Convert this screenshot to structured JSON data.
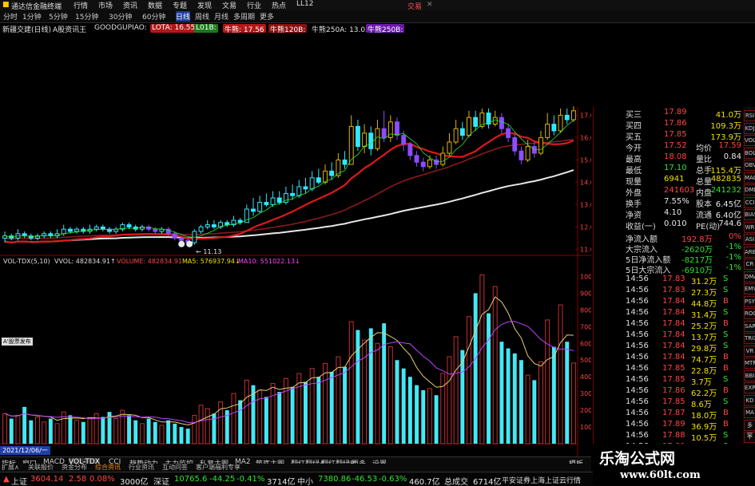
{
  "window": {
    "title": "通达信金融终端",
    "title_right": "交易",
    "close_label": "✕"
  },
  "menu": [
    "行情",
    "市场",
    "资讯",
    "数据",
    "专题",
    "发现",
    "文易",
    "行业",
    "热点",
    "LL12"
  ],
  "periods": [
    "分时",
    "1分钟",
    "5分钟",
    "15分钟",
    "30分钟",
    "60分钟",
    "日线",
    "周线",
    "月线",
    "多周期",
    "更多"
  ],
  "info": {
    "name": "新疆交建(日线)",
    "tool": "A股资讯王",
    "formula": "GOODGUPIAO:",
    "ma250": "牛熊250A: 13.05",
    "chips": [
      "LOTA: 16.55",
      "L01B: ",
      "牛熊: 17.56",
      "牛熊120B:",
      "牛熊250B:"
    ]
  },
  "price_axis": [
    "17.00",
    "16.00",
    "15.00",
    "14.00",
    "13.00",
    "12.00",
    "11.00"
  ],
  "low_label": "← 11.13",
  "vol_header": {
    "ind": "VOL-TDX(5,10)",
    "vvol": "VVOL: 482834.91↑",
    "volume": "VOLUME: 482834.91",
    "ma5": "MA5: 576937.94↓",
    "ma10": "MA10: 551022.13↓"
  },
  "vol_axis": [
    "10000",
    "9000",
    "8000",
    "7000",
    "6000",
    "5000",
    "4000",
    "3000",
    "2000",
    "1000"
  ],
  "vol_badge": "5573",
  "cursor_date": "2021/12/06/一",
  "sidebox_label": "A'股票发布",
  "quote": [
    {
      "l": "买三",
      "v": "17.89",
      "r": "41.0万",
      "lc": "red",
      "rc": "yellow"
    },
    {
      "l": "买四",
      "v": "17.86",
      "r": "109.3万",
      "lc": "red",
      "rc": "yellow"
    },
    {
      "l": "买五",
      "v": "17.85",
      "r": "173.9万",
      "lc": "red",
      "rc": "yellow"
    },
    {
      "l": "今开",
      "v": "17.52",
      "m": "均价",
      "r": "17.59",
      "lc": "red",
      "rc": "red"
    },
    {
      "l": "最高",
      "v": "18.08",
      "m": "量比",
      "r": "0.84",
      "lc": "red",
      "rc": "white"
    },
    {
      "l": "最低",
      "v": "17.10",
      "m": "总手",
      "r": "115.4万",
      "lc": "green",
      "rc": "yellow"
    },
    {
      "l": "现量",
      "v": "6941",
      "m": "总量",
      "r": "482835",
      "lc": "yellow",
      "rc": "yellow"
    },
    {
      "l": "外盘",
      "v": "241603",
      "m": "内盘",
      "r": "241232",
      "lc": "red",
      "rc": "green"
    },
    {
      "l": "换手",
      "v": "7.55%",
      "m": "股本",
      "r": "6.45亿",
      "lc": "white",
      "rc": "white"
    },
    {
      "l": "净资",
      "v": "4.10",
      "m": "流通",
      "r": "6.40亿",
      "lc": "white",
      "rc": "white"
    },
    {
      "l": "收益(一)",
      "v": "0.010",
      "m": "PE(动)",
      "r": "744.6",
      "lc": "white",
      "rc": "white"
    }
  ],
  "flows": [
    {
      "l": "净流入额",
      "v": "192.8万",
      "r": "0%",
      "vc": "red"
    },
    {
      "l": "大宗流入",
      "v": "-2620万",
      "r": "-1%",
      "vc": "green"
    },
    {
      "l": "5日净流入额",
      "v": "-8217万",
      "r": "-1%",
      "vc": "green"
    },
    {
      "l": "5日大宗流入",
      "v": "-6910万",
      "r": "-1%",
      "vc": "green"
    }
  ],
  "ticks": [
    [
      "14:56",
      "17.83",
      "31.2万",
      "S"
    ],
    [
      "14:56",
      "17.83",
      "27.3万",
      "S"
    ],
    [
      "14:56",
      "17.84",
      "44.8万",
      "B"
    ],
    [
      "14:56",
      "17.84",
      "31.4万",
      "S"
    ],
    [
      "14:56",
      "17.84",
      "25.2万",
      "B"
    ],
    [
      "14:56",
      "17.84",
      "13.7万",
      "S"
    ],
    [
      "14:56",
      "17.84",
      "29.8万",
      "S"
    ],
    [
      "14:56",
      "17.84",
      "74.7万",
      "B"
    ],
    [
      "14:56",
      "17.85",
      "22.8万",
      "B"
    ],
    [
      "14:56",
      "17.85",
      "3.7万",
      "S"
    ],
    [
      "14:56",
      "17.86",
      "62.2万",
      "B"
    ],
    [
      "14:56",
      "17.85",
      "8.6万",
      "S"
    ],
    [
      "14:56",
      "17.87",
      "18.0万",
      "B"
    ],
    [
      "14:56",
      "17.89",
      "36.9万",
      "B"
    ],
    [
      "14:56",
      "17.88",
      "10.5万",
      "S"
    ],
    [
      "14:56",
      "17.89",
      "23.6万",
      "S"
    ]
  ],
  "side_icons": [
    "RSI",
    "KDJ",
    "VOL",
    "BOLL",
    "OBV",
    "MACD",
    "DMI",
    "CCI",
    "BIAS",
    "WR",
    "ASI",
    "ARBR",
    "CR",
    "DMA",
    "EMV",
    "PSY",
    "ROC",
    "SAR",
    "TRIX",
    "VR",
    "MTM",
    "BBI",
    "EXPMA",
    "KD",
    "MA",
    "多空",
    "个股",
    "指标"
  ],
  "bottom_tabs": [
    "指标",
    "窗口",
    "MACD",
    "VOL-TDX",
    "CCI",
    "趋势动力",
    "主力监控",
    "私募主图",
    "MA2",
    "筑底主图",
    "翻红翻绿A",
    "翻红翻绿B",
    "更多",
    "设置",
    "模板"
  ],
  "bottom_tabs2": [
    "扩展∧",
    "关联报价",
    "资金分布",
    "综合资讯",
    "行业资讯",
    "互动问答",
    "客户端福利专享"
  ],
  "status": {
    "sh_label": "上证",
    "sh_val": "3604.14",
    "sh_chg": "2.58",
    "sh_pct": "0.08%",
    "sh_amt": "3000亿",
    "sz_label": "深证",
    "sz_val": "10765.6",
    "sz_chg": "-44.25",
    "sz_pct": "-0.41%",
    "sz_amt": "3714亿",
    "zx_label": "中小",
    "zx_val": "7380.86",
    "zx_chg": "-46.53",
    "zx_pct": "-0.63%",
    "zx_amt": "460.7亿",
    "total_label": "总成交",
    "total_val": "6714亿",
    "broker": "平安证券上海上证云行情"
  },
  "watermark": {
    "title": "乐淘公式网",
    "url": "www.60lt.com"
  },
  "chart_data": {
    "type": "candlestick-volume",
    "price_ylim": [
      10.8,
      17.3
    ],
    "vol_ylim": [
      0,
      10500
    ],
    "volume_scale_note": "",
    "candles": [
      {
        "o": 11.5,
        "c": 11.6,
        "h": 11.8,
        "l": 11.3,
        "v": 1800
      },
      {
        "o": 11.6,
        "c": 11.5,
        "h": 11.7,
        "l": 11.4,
        "v": 1500
      },
      {
        "o": 11.5,
        "c": 11.7,
        "h": 11.9,
        "l": 11.4,
        "v": 1700
      },
      {
        "o": 11.7,
        "c": 11.6,
        "h": 11.8,
        "l": 11.5,
        "v": 2200
      },
      {
        "o": 11.6,
        "c": 11.5,
        "h": 11.7,
        "l": 11.4,
        "v": 1400
      },
      {
        "o": 11.5,
        "c": 11.6,
        "h": 11.7,
        "l": 11.4,
        "v": 1600
      },
      {
        "o": 11.6,
        "c": 11.7,
        "h": 11.8,
        "l": 11.5,
        "v": 1300
      },
      {
        "o": 11.7,
        "c": 11.6,
        "h": 11.8,
        "l": 11.5,
        "v": 1500
      },
      {
        "o": 11.6,
        "c": 11.7,
        "h": 11.9,
        "l": 11.5,
        "v": 1200
      },
      {
        "o": 11.7,
        "c": 11.9,
        "h": 12.1,
        "l": 11.6,
        "v": 1900
      },
      {
        "o": 11.9,
        "c": 11.8,
        "h": 12.0,
        "l": 11.7,
        "v": 1700
      },
      {
        "o": 11.8,
        "c": 11.9,
        "h": 12.0,
        "l": 11.7,
        "v": 1400
      },
      {
        "o": 11.9,
        "c": 11.8,
        "h": 12.0,
        "l": 11.7,
        "v": 1300
      },
      {
        "o": 11.8,
        "c": 11.9,
        "h": 12.1,
        "l": 11.7,
        "v": 1500
      },
      {
        "o": 11.9,
        "c": 12.0,
        "h": 12.1,
        "l": 11.8,
        "v": 1800
      },
      {
        "o": 12.0,
        "c": 11.9,
        "h": 12.1,
        "l": 11.8,
        "v": 1600
      },
      {
        "o": 11.9,
        "c": 11.8,
        "h": 12.0,
        "l": 11.7,
        "v": 1900
      },
      {
        "o": 11.8,
        "c": 11.9,
        "h": 12.0,
        "l": 11.7,
        "v": 1500
      },
      {
        "o": 11.9,
        "c": 12.1,
        "h": 12.2,
        "l": 11.8,
        "v": 2000
      },
      {
        "o": 12.1,
        "c": 12.0,
        "h": 12.2,
        "l": 11.9,
        "v": 1700
      },
      {
        "o": 12.0,
        "c": 11.9,
        "h": 12.1,
        "l": 11.8,
        "v": 1400
      },
      {
        "o": 11.9,
        "c": 12.0,
        "h": 12.1,
        "l": 11.8,
        "v": 1200
      },
      {
        "o": 12.0,
        "c": 11.9,
        "h": 12.1,
        "l": 11.8,
        "v": 1500
      },
      {
        "o": 11.9,
        "c": 11.8,
        "h": 12.0,
        "l": 11.7,
        "v": 1300
      },
      {
        "o": 11.8,
        "c": 11.9,
        "h": 12.0,
        "l": 11.7,
        "v": 1100
      },
      {
        "o": 11.9,
        "c": 11.7,
        "h": 12.0,
        "l": 11.6,
        "v": 1400
      },
      {
        "o": 11.7,
        "c": 11.5,
        "h": 11.8,
        "l": 11.4,
        "v": 1200
      },
      {
        "o": 11.5,
        "c": 11.4,
        "h": 11.6,
        "l": 11.2,
        "v": 1000
      },
      {
        "o": 11.4,
        "c": 11.3,
        "h": 11.5,
        "l": 11.13,
        "v": 900
      },
      {
        "o": 11.3,
        "c": 11.8,
        "h": 11.9,
        "l": 11.2,
        "v": 1700
      },
      {
        "o": 11.8,
        "c": 12.0,
        "h": 12.1,
        "l": 11.7,
        "v": 2300
      },
      {
        "o": 12.0,
        "c": 12.1,
        "h": 12.3,
        "l": 11.9,
        "v": 2100
      },
      {
        "o": 12.1,
        "c": 12.0,
        "h": 12.3,
        "l": 11.9,
        "v": 1800
      },
      {
        "o": 12.0,
        "c": 12.2,
        "h": 12.3,
        "l": 11.9,
        "v": 2500
      },
      {
        "o": 12.2,
        "c": 12.1,
        "h": 12.3,
        "l": 12.0,
        "v": 2000
      },
      {
        "o": 12.1,
        "c": 12.3,
        "h": 12.5,
        "l": 12.0,
        "v": 3000
      },
      {
        "o": 12.3,
        "c": 12.2,
        "h": 12.4,
        "l": 12.1,
        "v": 2600
      },
      {
        "o": 12.2,
        "c": 12.8,
        "h": 13.0,
        "l": 12.2,
        "v": 3800
      },
      {
        "o": 12.8,
        "c": 12.7,
        "h": 13.3,
        "l": 12.5,
        "v": 3500
      },
      {
        "o": 12.7,
        "c": 13.1,
        "h": 13.4,
        "l": 12.6,
        "v": 3200
      },
      {
        "o": 13.1,
        "c": 13.0,
        "h": 13.5,
        "l": 12.9,
        "v": 2800
      },
      {
        "o": 13.0,
        "c": 13.3,
        "h": 13.6,
        "l": 12.9,
        "v": 3600
      },
      {
        "o": 13.3,
        "c": 13.1,
        "h": 13.6,
        "l": 13.0,
        "v": 3100
      },
      {
        "o": 13.1,
        "c": 13.5,
        "h": 13.8,
        "l": 13.0,
        "v": 3900
      },
      {
        "o": 13.5,
        "c": 13.4,
        "h": 13.9,
        "l": 13.2,
        "v": 3400
      },
      {
        "o": 13.4,
        "c": 13.8,
        "h": 14.1,
        "l": 13.3,
        "v": 4200
      },
      {
        "o": 13.8,
        "c": 13.7,
        "h": 14.2,
        "l": 13.5,
        "v": 3700
      },
      {
        "o": 13.7,
        "c": 14.2,
        "h": 14.5,
        "l": 13.6,
        "v": 4500
      },
      {
        "o": 14.2,
        "c": 14.0,
        "h": 14.6,
        "l": 13.9,
        "v": 4000
      },
      {
        "o": 14.0,
        "c": 14.5,
        "h": 14.8,
        "l": 13.9,
        "v": 4800
      },
      {
        "o": 14.5,
        "c": 14.3,
        "h": 14.9,
        "l": 14.1,
        "v": 4300
      },
      {
        "o": 14.3,
        "c": 15.0,
        "h": 15.3,
        "l": 14.2,
        "v": 5200
      },
      {
        "o": 15.0,
        "c": 14.8,
        "h": 15.4,
        "l": 14.6,
        "v": 4600
      },
      {
        "o": 14.8,
        "c": 16.5,
        "h": 17.0,
        "l": 14.8,
        "v": 7300
      },
      {
        "o": 16.5,
        "c": 15.6,
        "h": 16.8,
        "l": 15.4,
        "v": 6800
      },
      {
        "o": 15.6,
        "c": 16.2,
        "h": 16.6,
        "l": 15.3,
        "v": 6200
      },
      {
        "o": 16.2,
        "c": 15.5,
        "h": 16.5,
        "l": 15.2,
        "v": 6900
      },
      {
        "o": 15.5,
        "c": 16.4,
        "h": 16.8,
        "l": 15.4,
        "v": 6000
      },
      {
        "o": 16.4,
        "c": 16.0,
        "h": 17.2,
        "l": 15.8,
        "v": 7200
      },
      {
        "o": 16.0,
        "c": 16.7,
        "h": 17.0,
        "l": 15.8,
        "v": 5800
      },
      {
        "o": 16.7,
        "c": 16.1,
        "h": 16.9,
        "l": 15.9,
        "v": 5000
      },
      {
        "o": 16.1,
        "c": 15.7,
        "h": 16.3,
        "l": 15.4,
        "v": 4500
      },
      {
        "o": 15.7,
        "c": 15.2,
        "h": 15.8,
        "l": 15.0,
        "v": 4000
      },
      {
        "o": 15.2,
        "c": 14.9,
        "h": 15.4,
        "l": 14.7,
        "v": 3500
      },
      {
        "o": 14.9,
        "c": 14.7,
        "h": 15.1,
        "l": 14.5,
        "v": 3200
      },
      {
        "o": 14.7,
        "c": 15.0,
        "h": 15.2,
        "l": 14.6,
        "v": 3300
      },
      {
        "o": 15.0,
        "c": 14.8,
        "h": 15.2,
        "l": 14.6,
        "v": 2900
      },
      {
        "o": 14.8,
        "c": 15.3,
        "h": 15.6,
        "l": 14.7,
        "v": 4200
      },
      {
        "o": 15.3,
        "c": 15.8,
        "h": 16.2,
        "l": 15.2,
        "v": 5200
      },
      {
        "o": 15.8,
        "c": 16.4,
        "h": 16.8,
        "l": 15.7,
        "v": 6400
      },
      {
        "o": 16.4,
        "c": 16.1,
        "h": 16.7,
        "l": 15.9,
        "v": 5600
      },
      {
        "o": 16.1,
        "c": 16.9,
        "h": 17.2,
        "l": 16.0,
        "v": 7600
      },
      {
        "o": 16.9,
        "c": 16.5,
        "h": 17.2,
        "l": 16.3,
        "v": 9000
      },
      {
        "o": 16.5,
        "c": 17.1,
        "h": 17.3,
        "l": 16.4,
        "v": 10100
      },
      {
        "o": 17.1,
        "c": 16.6,
        "h": 17.3,
        "l": 16.4,
        "v": 7800
      },
      {
        "o": 16.6,
        "c": 16.9,
        "h": 17.2,
        "l": 16.5,
        "v": 9400
      },
      {
        "o": 16.9,
        "c": 16.4,
        "h": 17.1,
        "l": 16.2,
        "v": 6100
      },
      {
        "o": 16.4,
        "c": 16.0,
        "h": 16.6,
        "l": 15.8,
        "v": 5700
      },
      {
        "o": 16.0,
        "c": 15.4,
        "h": 16.2,
        "l": 15.2,
        "v": 5400
      },
      {
        "o": 15.4,
        "c": 15.0,
        "h": 15.6,
        "l": 14.8,
        "v": 5000
      },
      {
        "o": 15.0,
        "c": 15.6,
        "h": 15.9,
        "l": 14.9,
        "v": 4100
      },
      {
        "o": 15.6,
        "c": 15.3,
        "h": 15.8,
        "l": 15.1,
        "v": 3800
      },
      {
        "o": 15.3,
        "c": 16.0,
        "h": 16.3,
        "l": 15.2,
        "v": 4900
      },
      {
        "o": 16.0,
        "c": 16.6,
        "h": 17.1,
        "l": 15.9,
        "v": 7400
      },
      {
        "o": 16.6,
        "c": 16.3,
        "h": 17.0,
        "l": 16.1,
        "v": 5800
      },
      {
        "o": 16.3,
        "c": 17.0,
        "h": 17.3,
        "l": 16.2,
        "v": 8300
      },
      {
        "o": 17.0,
        "c": 16.8,
        "h": 17.3,
        "l": 16.6,
        "v": 6100
      },
      {
        "o": 16.8,
        "c": 17.2,
        "h": 17.4,
        "l": 16.7,
        "v": 4828
      }
    ]
  }
}
